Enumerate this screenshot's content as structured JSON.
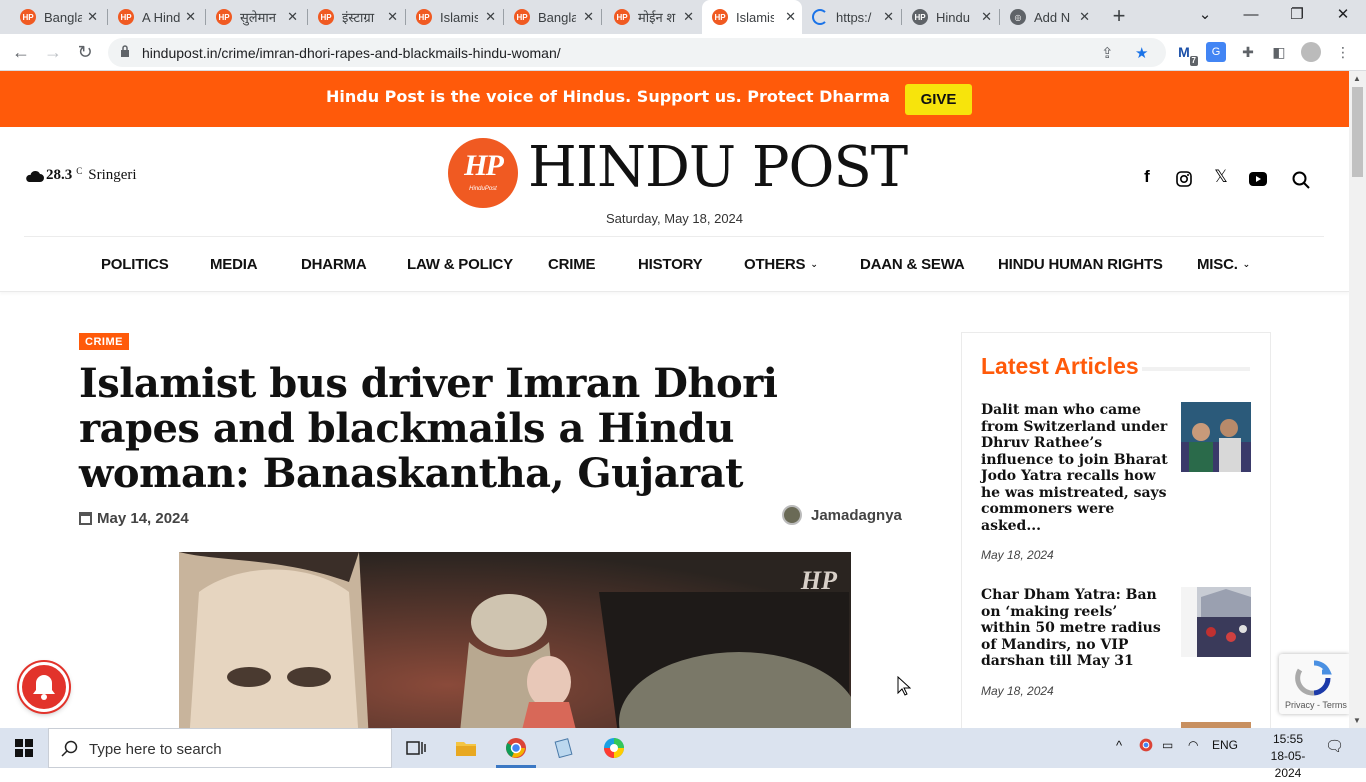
{
  "browser": {
    "tabs": [
      {
        "title": "Bangla",
        "icon": "hindupost-favicon"
      },
      {
        "title": "A Hind",
        "icon": "hindupost-favicon"
      },
      {
        "title": "सुलेमान",
        "icon": "hindupost-favicon"
      },
      {
        "title": "इंस्टाग्रा",
        "icon": "hindupost-favicon"
      },
      {
        "title": "Islamis",
        "icon": "hindupost-favicon"
      },
      {
        "title": "Bangla",
        "icon": "hindupost-favicon"
      },
      {
        "title": "मोईन श",
        "icon": "hindupost-favicon"
      },
      {
        "title": "Islamis",
        "icon": "hindupost-favicon",
        "active": true
      },
      {
        "title": "https:/",
        "icon": "loading-spinner"
      },
      {
        "title": "Hindu",
        "icon": "hindupost-favicon"
      },
      {
        "title": "Add N",
        "icon": "globe-icon"
      }
    ],
    "url": "hindupost.in/crime/imran-dhori-rapes-and-blackmails-hindu-woman/",
    "extension_badge": "7"
  },
  "banner": {
    "message": "Hindu Post is the voice of Hindus. Support us. Protect Dharma",
    "give_label": "GIVE"
  },
  "header": {
    "weather": {
      "temp": "28.3",
      "unit": "C",
      "location": "Sringeri"
    },
    "logo_mark_text": "HP",
    "logo_mark_sub": "HinduPost",
    "logo_text": "HINDU POST",
    "date": "Saturday, May 18, 2024"
  },
  "nav": [
    {
      "label": "POLITICS"
    },
    {
      "label": "MEDIA"
    },
    {
      "label": "DHARMA"
    },
    {
      "label": "LAW & POLICY"
    },
    {
      "label": "CRIME"
    },
    {
      "label": "HISTORY"
    },
    {
      "label": "OTHERS",
      "dropdown": true
    },
    {
      "label": "DAAN & SEWA"
    },
    {
      "label": "HINDU HUMAN RIGHTS"
    },
    {
      "label": "MISC.",
      "dropdown": true
    }
  ],
  "article": {
    "category": "CRIME",
    "title": "Islamist bus driver Imran Dhori rapes and blackmails a Hindu woman: Banaskantha, Gujarat",
    "date": "May 14, 2024",
    "author": "Jamadagnya",
    "image_watermark": "HP"
  },
  "sidebar": {
    "title": "Latest Articles",
    "articles": [
      {
        "title": "Dalit man who came from Switzerland under Dhruv Rathee’s influence to join Bharat Jodo Yatra recalls how he was mistreated, says commoners were asked...",
        "date": "May 18, 2024"
      },
      {
        "title": "Char Dham Yatra: Ban on ‘making reels’ within 50 metre radius of Mandirs, no VIP darshan till May 31",
        "date": "May 18, 2024"
      }
    ]
  },
  "recaptcha": {
    "text": "Privacy - Terms"
  },
  "taskbar": {
    "search_placeholder": "Type here to search",
    "language": "ENG",
    "time": "15:55",
    "date": "18-05-2024"
  },
  "colors": {
    "brand_orange": "#ff5a0a",
    "give_yellow": "#f7e40c",
    "notification_red": "#e2332b"
  }
}
